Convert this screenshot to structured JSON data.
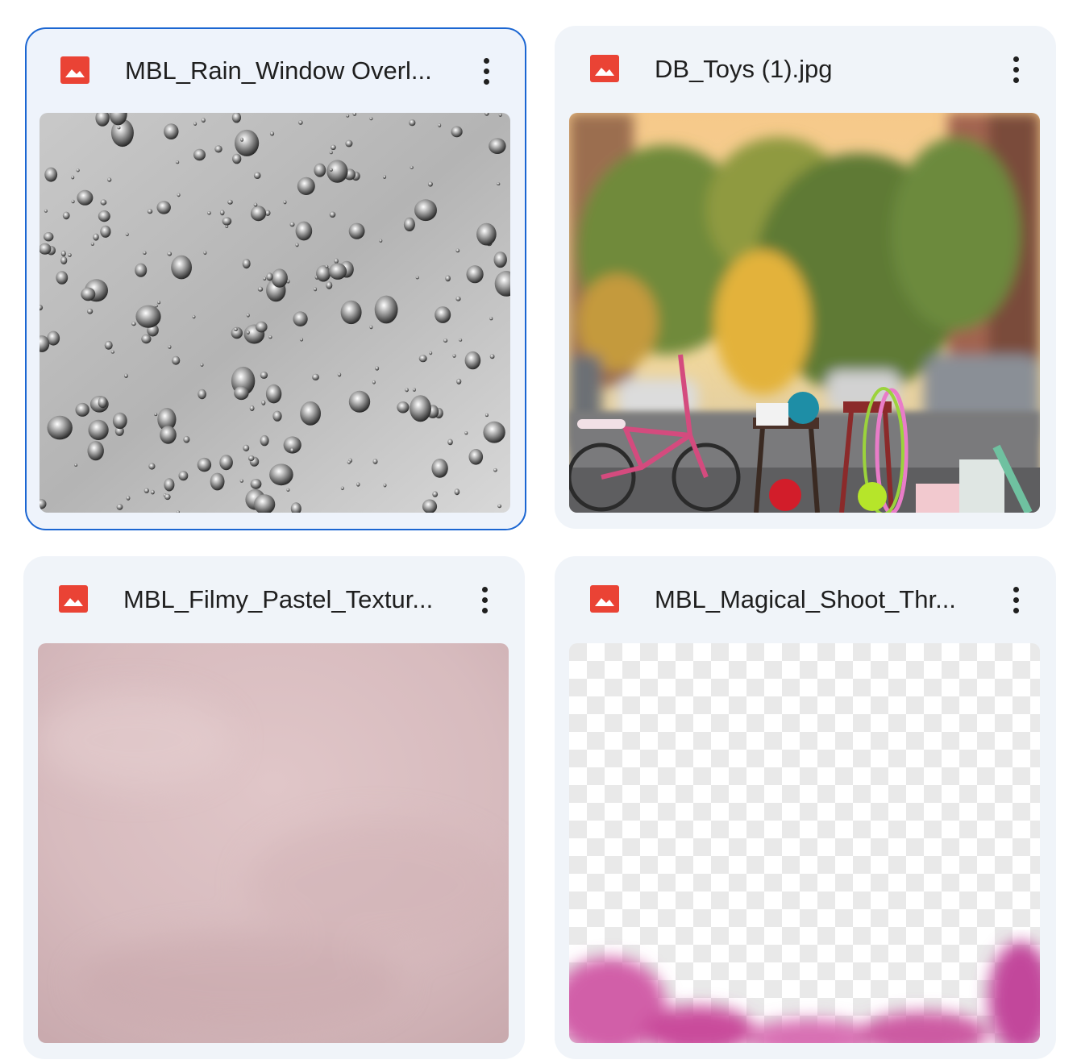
{
  "files": [
    {
      "name": "MBL_Rain_Window Overl...",
      "thumbnail": "rain-drops-on-window-grayscale",
      "icon": "image-file-icon",
      "selected": true
    },
    {
      "name": "DB_Toys (1).jpg",
      "thumbnail": "street-with-pink-bicycle-and-toys",
      "icon": "image-file-icon",
      "selected": false
    },
    {
      "name": "MBL_Filmy_Pastel_Textur...",
      "thumbnail": "pastel-pink-texture",
      "icon": "image-file-icon",
      "selected": false
    },
    {
      "name": "MBL_Magical_Shoot_Thr...",
      "thumbnail": "transparent-with-pink-flowers-bottom",
      "icon": "image-file-icon",
      "selected": false
    }
  ],
  "colors": {
    "icon_red": "#ea4335",
    "card_bg": "#f0f4f9",
    "selected_border": "#1b66d2",
    "text": "#1f1f1f"
  }
}
